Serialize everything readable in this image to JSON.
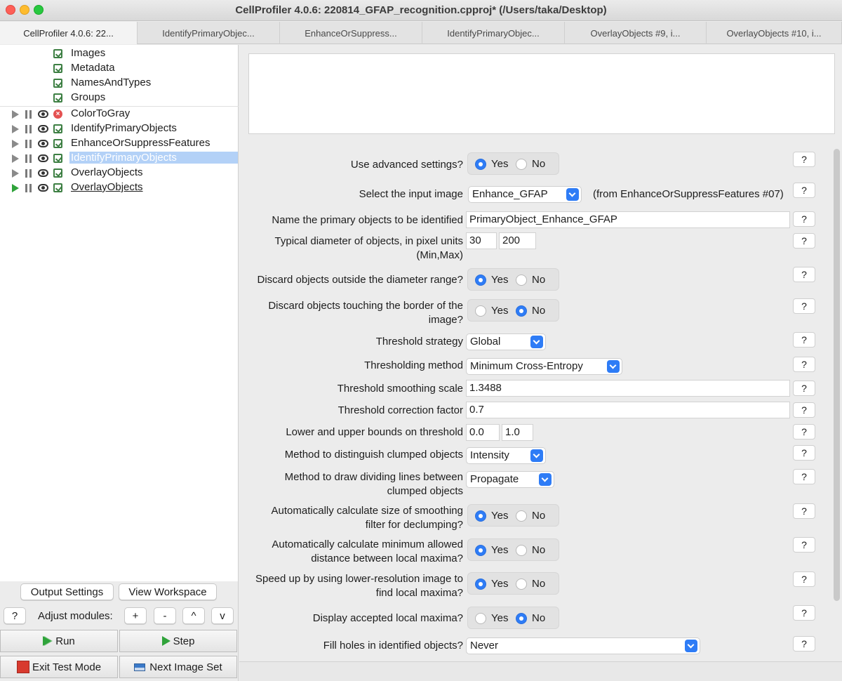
{
  "window": {
    "title": "CellProfiler 4.0.6: 220814_GFAP_recognition.cpproj* (/Users/taka/Desktop)"
  },
  "tabs": [
    {
      "label": "CellProfiler 4.0.6: 22..."
    },
    {
      "label": "IdentifyPrimaryObjec..."
    },
    {
      "label": "EnhanceOrSuppress..."
    },
    {
      "label": "IdentifyPrimaryObjec..."
    },
    {
      "label": "OverlayObjects #9, i..."
    },
    {
      "label": "OverlayObjects #10, i..."
    }
  ],
  "input_modules": [
    {
      "label": "Images"
    },
    {
      "label": "Metadata"
    },
    {
      "label": "NamesAndTypes"
    },
    {
      "label": "Groups"
    }
  ],
  "pipeline": [
    {
      "label": "ColorToGray",
      "status": "error",
      "state": "normal"
    },
    {
      "label": "IdentifyPrimaryObjects",
      "status": "ok",
      "state": "normal"
    },
    {
      "label": "EnhanceOrSuppressFeatures",
      "status": "ok",
      "state": "normal"
    },
    {
      "label": "IdentifyPrimaryObjects",
      "status": "ok",
      "state": "selected"
    },
    {
      "label": "OverlayObjects",
      "status": "ok",
      "state": "normal"
    },
    {
      "label": "OverlayObjects",
      "status": "ok",
      "state": "current"
    }
  ],
  "controls": {
    "output_settings": "Output Settings",
    "view_workspace": "View Workspace",
    "help": "?",
    "adjust_modules": "Adjust modules:",
    "add": "+",
    "remove": "-",
    "move_up": "^",
    "move_down": "v",
    "run": "Run",
    "step": "Step",
    "exit_test_mode": "Exit Test Mode",
    "next_image_set": "Next Image Set"
  },
  "settings": {
    "help_label": "?",
    "yes": "Yes",
    "no": "No",
    "advanced_label": "Use advanced settings?",
    "advanced_value": "Yes",
    "input_image_label": "Select the input image",
    "input_image_value": "Enhance_GFAP",
    "input_image_source": "(from EnhanceOrSuppressFeatures #07)",
    "primary_name_label": "Name the primary objects to be identified",
    "primary_name_value": "PrimaryObject_Enhance_GFAP",
    "diameter_label": "Typical diameter of objects, in pixel units (Min,Max)",
    "diameter_min": "30",
    "diameter_max": "200",
    "discard_outside_label": "Discard objects outside the diameter range?",
    "discard_outside_value": "Yes",
    "discard_border_label": "Discard objects touching the border of the image?",
    "discard_border_value": "No",
    "threshold_strategy_label": "Threshold strategy",
    "threshold_strategy_value": "Global",
    "threshold_method_label": "Thresholding method",
    "threshold_method_value": "Minimum Cross-Entropy",
    "smoothing_label": "Threshold smoothing scale",
    "smoothing_value": "1.3488",
    "correction_label": "Threshold correction factor",
    "correction_value": "0.7",
    "bounds_label": "Lower and upper bounds on threshold",
    "bounds_lower": "0.0",
    "bounds_upper": "1.0",
    "clumped_label": "Method to distinguish clumped objects",
    "clumped_value": "Intensity",
    "dividing_label": "Method to draw dividing lines between clumped objects",
    "dividing_value": "Propagate",
    "auto_filter_label": "Automatically calculate size of smoothing filter for declumping?",
    "auto_filter_value": "Yes",
    "auto_distance_label": "Automatically calculate minimum allowed distance between local maxima?",
    "auto_distance_value": "Yes",
    "lowres_label": "Speed up by using lower-resolution image to find local maxima?",
    "lowres_value": "Yes",
    "display_maxima_label": "Display accepted local maxima?",
    "display_maxima_value": "No",
    "fill_holes_label": "Fill holes in identified objects?",
    "fill_holes_value": "Never"
  },
  "colors": {
    "accent": "#2e7cf6",
    "selection": "#b3d1f7",
    "error": "#e45151",
    "ok": "#3d7f43",
    "run": "#2fa33a"
  }
}
